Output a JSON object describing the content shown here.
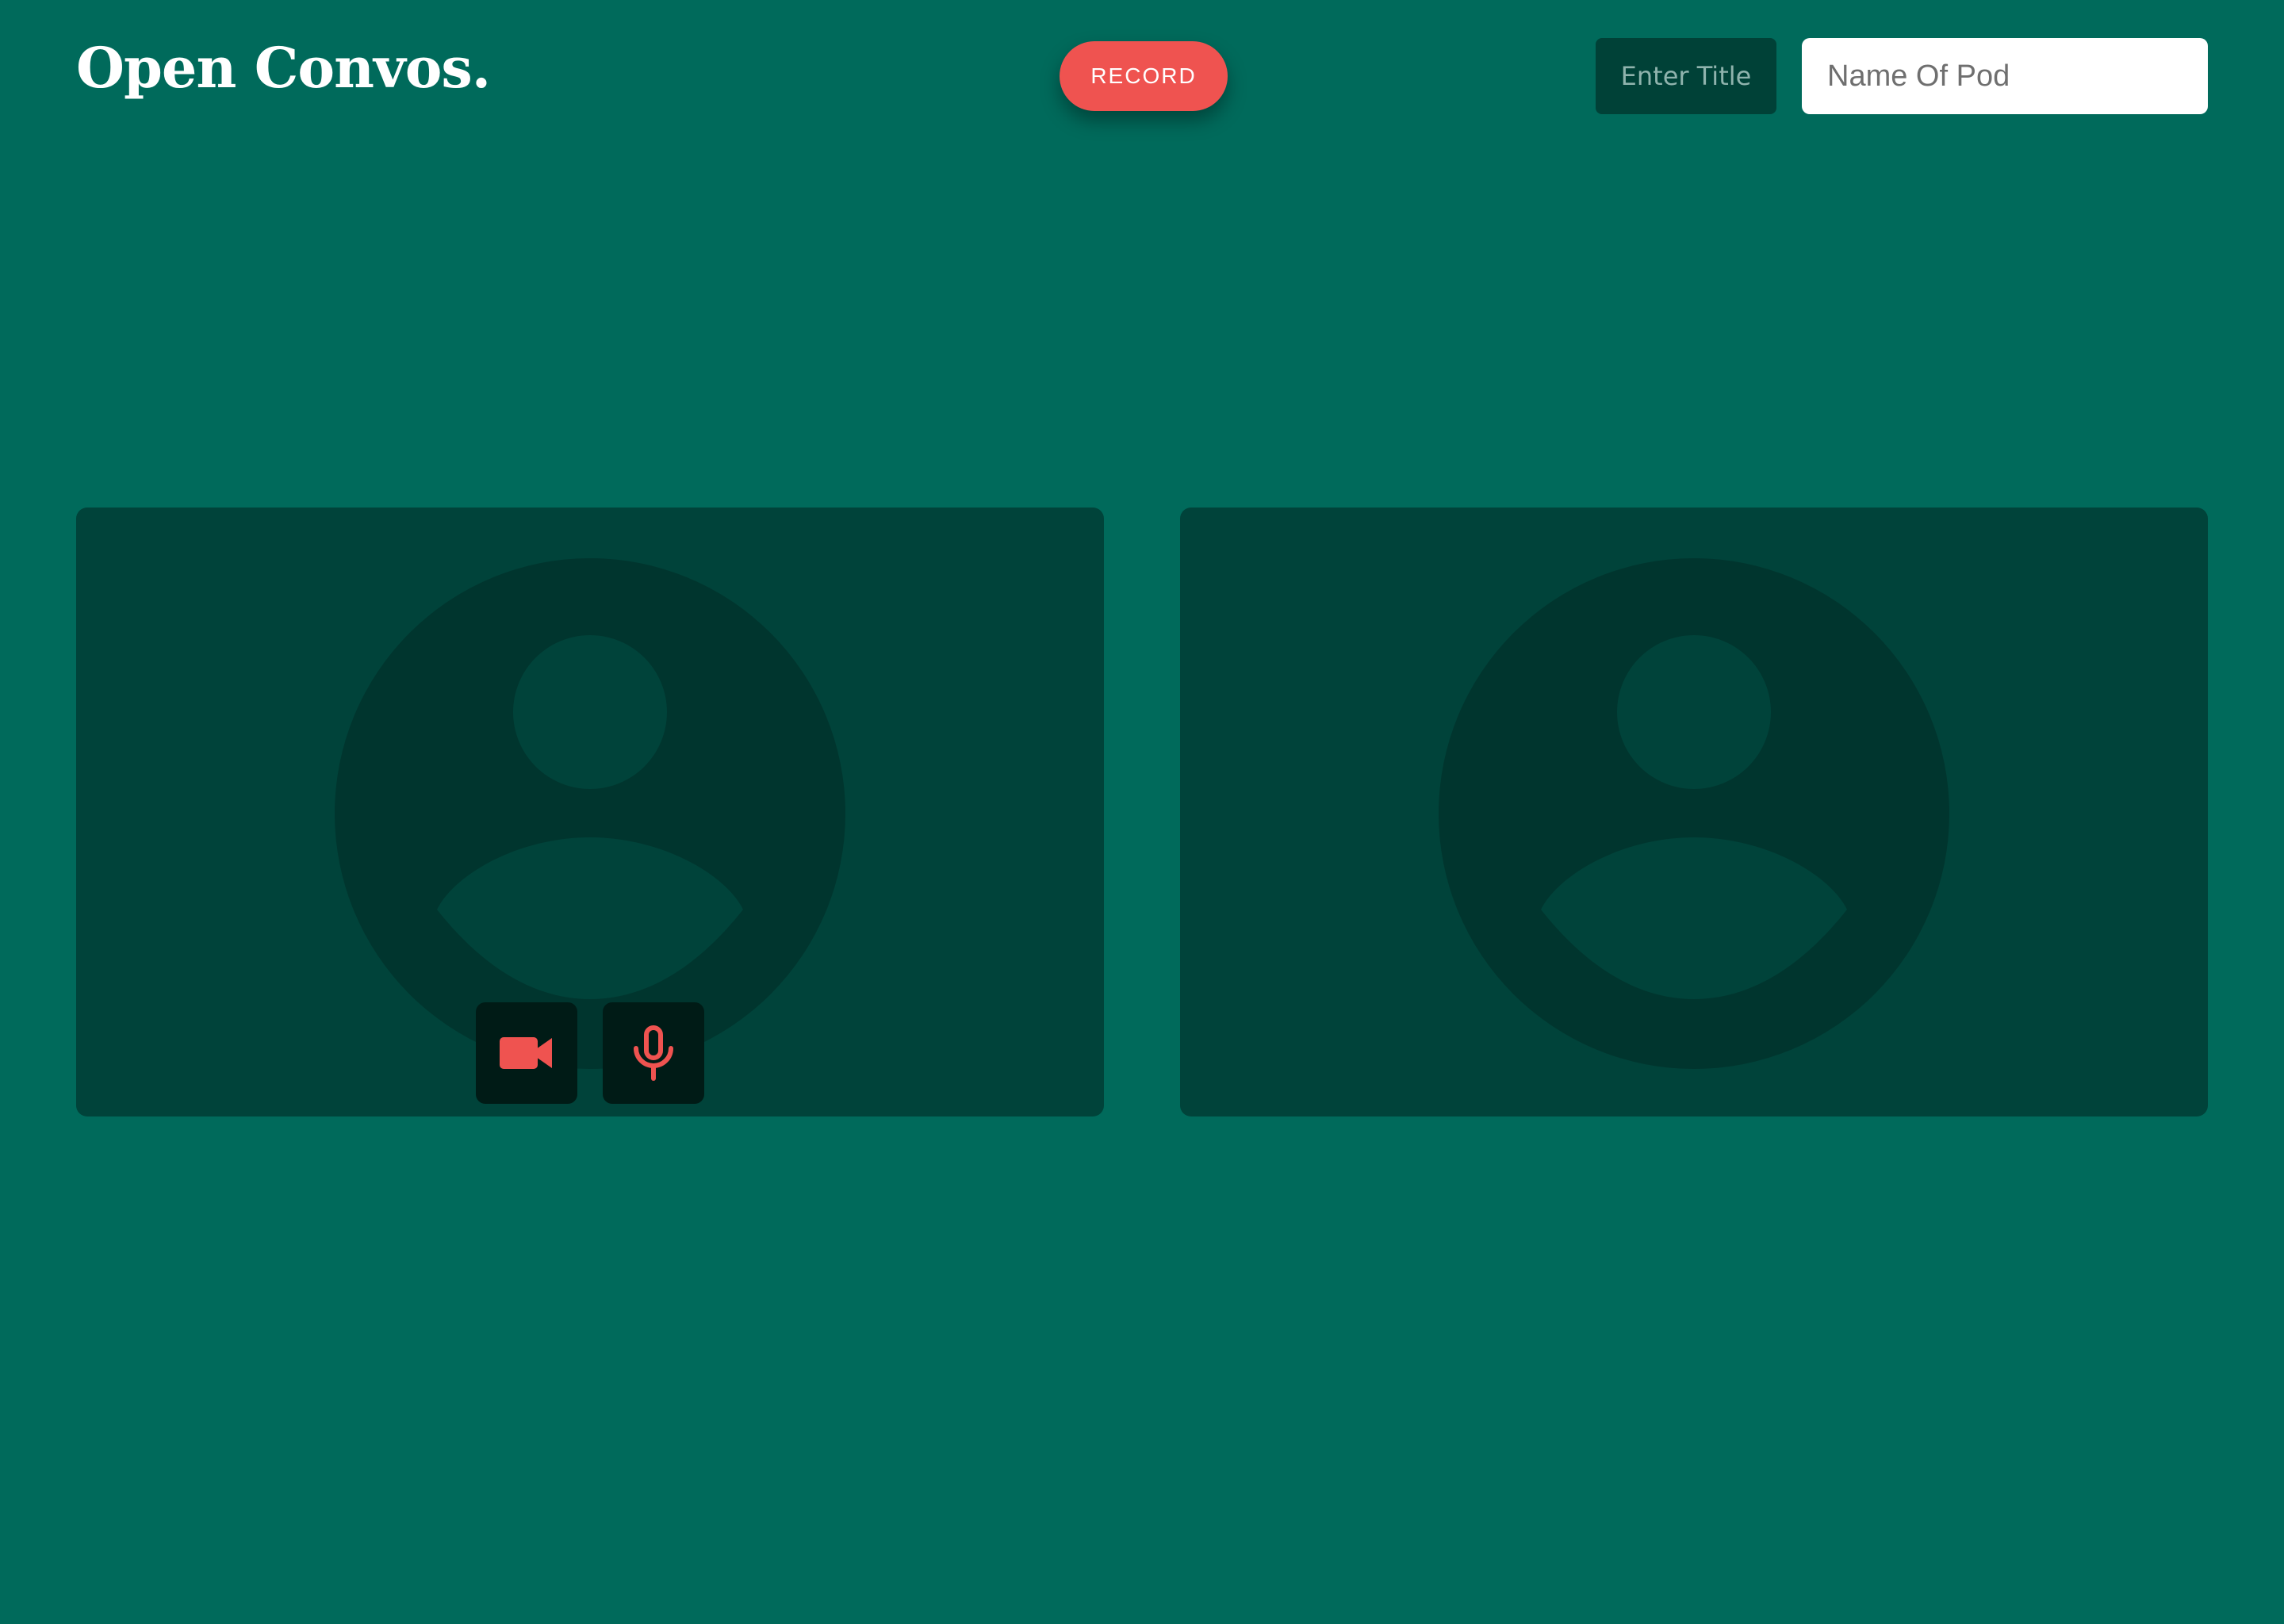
{
  "header": {
    "logo_text": "Open Convos.",
    "record_label": "RECORD",
    "title_button_label": "Enter Title",
    "pod_name_placeholder": "Name Of Pod"
  },
  "tiles": [
    {
      "avatar_icon": "user-avatar-icon",
      "controls": [
        {
          "icon": "video-camera-icon",
          "color": "#ef5350"
        },
        {
          "icon": "microphone-icon",
          "color": "#ef5350"
        }
      ]
    },
    {
      "avatar_icon": "user-avatar-icon"
    }
  ],
  "colors": {
    "background": "#006a5b",
    "tile": "#00433a",
    "accent": "#ef5350",
    "title_button": "#004137",
    "control_button": "#001b16"
  }
}
